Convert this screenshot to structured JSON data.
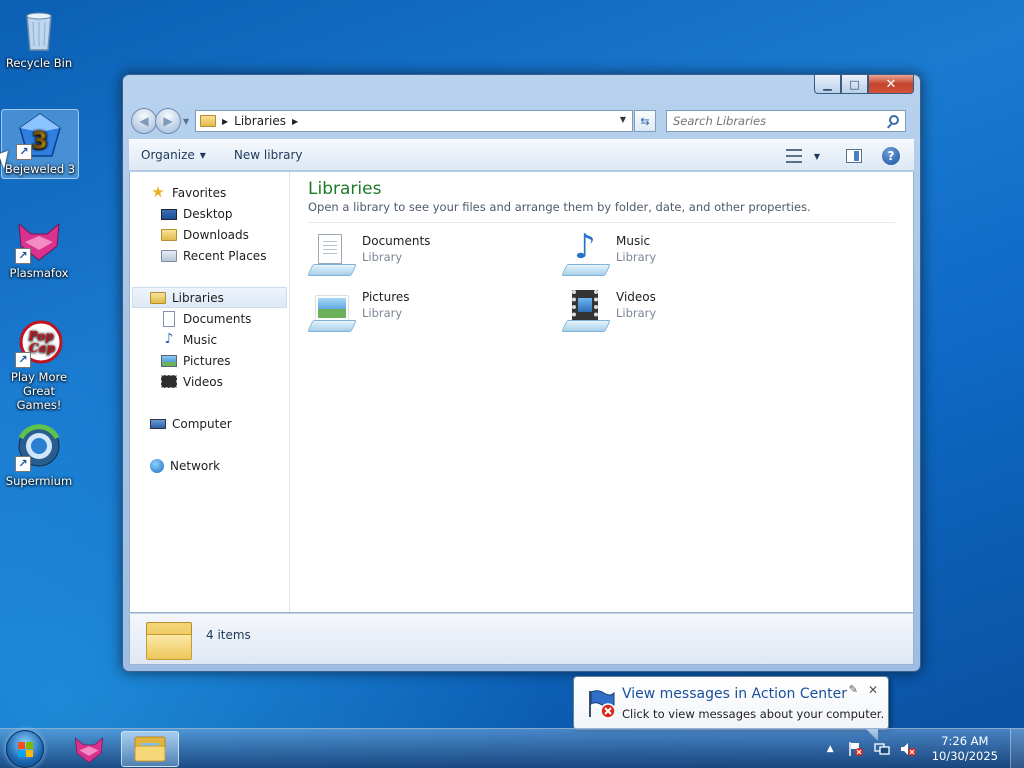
{
  "desktop": {
    "icons": [
      {
        "label": "Recycle Bin"
      },
      {
        "label": "Bejeweled 3"
      },
      {
        "label": "Plasmafox"
      },
      {
        "label": "Play More Great Games!"
      },
      {
        "label": "Supermium"
      }
    ]
  },
  "window": {
    "address": {
      "crumb": "Libraries"
    },
    "search": {
      "placeholder": "Search Libraries"
    },
    "toolbar": {
      "organize": "Organize",
      "new_library": "New library"
    },
    "nav": {
      "favorites": {
        "label": "Favorites",
        "items": [
          "Desktop",
          "Downloads",
          "Recent Places"
        ]
      },
      "libraries": {
        "label": "Libraries",
        "items": [
          "Documents",
          "Music",
          "Pictures",
          "Videos"
        ]
      },
      "computer": "Computer",
      "network": "Network"
    },
    "content": {
      "title": "Libraries",
      "subtitle": "Open a library to see your files and arrange them by folder, date, and other properties.",
      "items": [
        {
          "name": "Documents",
          "type": "Library"
        },
        {
          "name": "Music",
          "type": "Library"
        },
        {
          "name": "Pictures",
          "type": "Library"
        },
        {
          "name": "Videos",
          "type": "Library"
        }
      ]
    },
    "details": {
      "count": "4 items"
    }
  },
  "balloon": {
    "title": "View messages in Action Center",
    "text": "Click to view messages about your computer."
  },
  "taskbar": {
    "clock": {
      "time": "7:26 AM",
      "date": "10/30/2025"
    }
  },
  "colors": {
    "library_title": "#1e7a2b",
    "balloon_title": "#1a4f9b",
    "close_button": "#c3452b"
  }
}
